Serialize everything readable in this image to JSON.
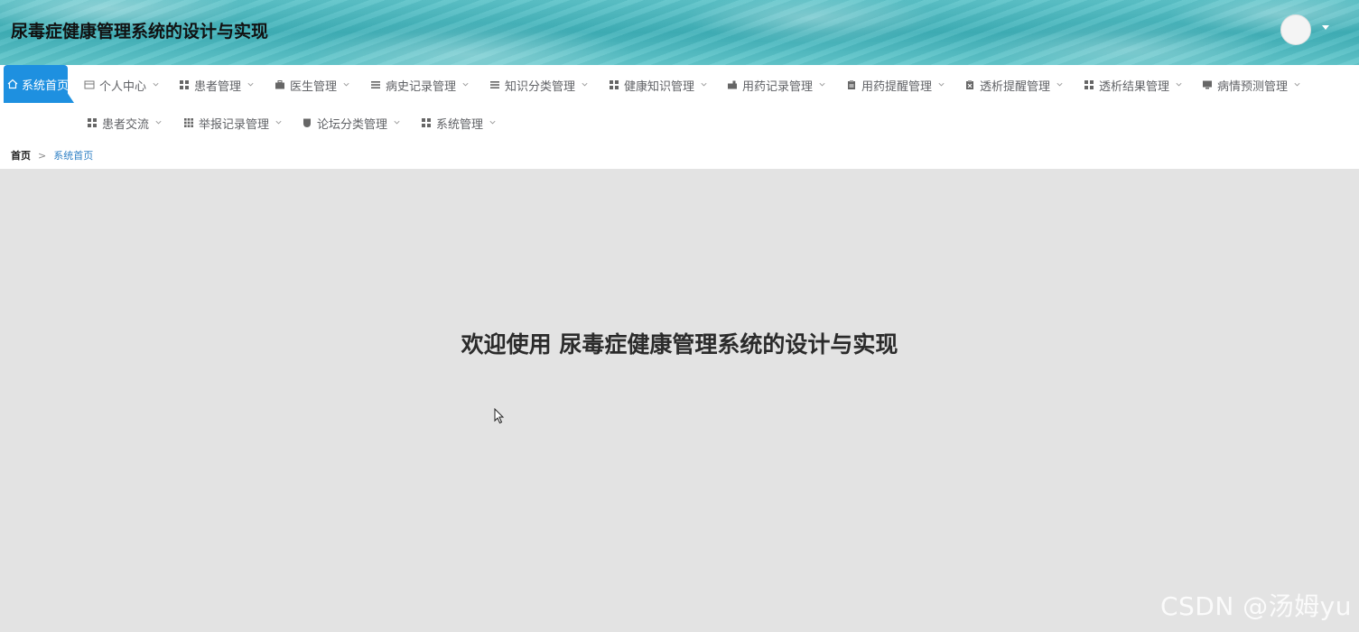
{
  "header": {
    "app_title": "尿毒症健康管理系统的设计与实现"
  },
  "nav": {
    "row1": [
      {
        "label": "系统首页",
        "icon": "home-icon",
        "active": true
      },
      {
        "label": "个人中心",
        "icon": "card-icon"
      },
      {
        "label": "患者管理",
        "icon": "grid-icon"
      },
      {
        "label": "医生管理",
        "icon": "briefcase-icon"
      },
      {
        "label": "病史记录管理",
        "icon": "list-icon"
      },
      {
        "label": "知识分类管理",
        "icon": "menu-icon"
      },
      {
        "label": "健康知识管理",
        "icon": "grid-icon"
      },
      {
        "label": "用药记录管理",
        "icon": "toolbox-icon"
      },
      {
        "label": "用药提醒管理",
        "icon": "clipboard-icon"
      },
      {
        "label": "透析提醒管理",
        "icon": "clipboard-x-icon"
      },
      {
        "label": "透析结果管理",
        "icon": "grid-icon"
      },
      {
        "label": "病情预测管理",
        "icon": "monitor-icon"
      }
    ],
    "row2": [
      {
        "label": "患者交流",
        "icon": "grid-icon"
      },
      {
        "label": "举报记录管理",
        "icon": "apps-icon"
      },
      {
        "label": "论坛分类管理",
        "icon": "shield-icon"
      },
      {
        "label": "系统管理",
        "icon": "grid-icon"
      }
    ]
  },
  "breadcrumb": {
    "home": "首页",
    "separator": ">",
    "current": "系统首页"
  },
  "main": {
    "welcome_text": "欢迎使用 尿毒症健康管理系统的设计与实现"
  },
  "watermark": "CSDN @汤姆yu",
  "colors": {
    "accent": "#1e90e0",
    "breadcrumb_current": "#2f80c5",
    "main_background": "#e3e3e3"
  }
}
